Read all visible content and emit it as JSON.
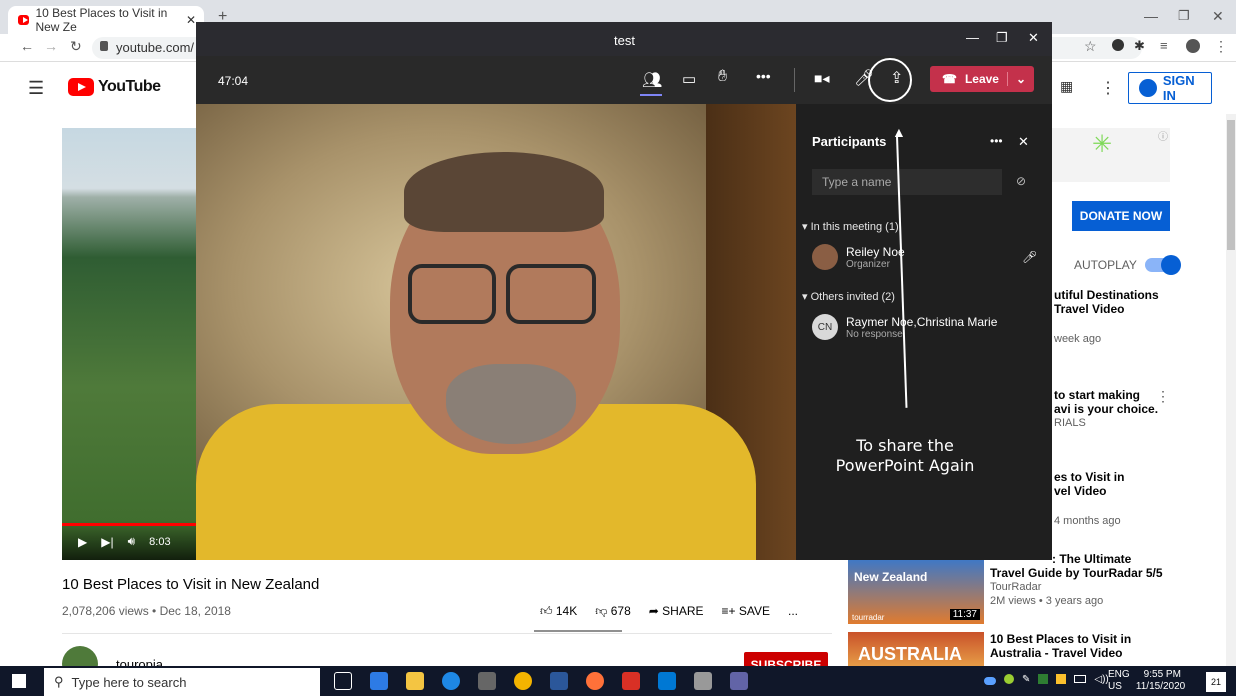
{
  "browser": {
    "tab_title": "10 Best Places to Visit in New Ze",
    "address": "youtube.com/"
  },
  "youtube": {
    "logo_text": "YouTube",
    "signin": "SIGN IN",
    "video_time": "8:03",
    "video_title": "10 Best Places to Visit in New Zealand",
    "video_meta": "2,078,206 views • Dec 18, 2018",
    "likes": "14K",
    "dislikes": "678",
    "share": "SHARE",
    "save": "SAVE",
    "more": "...",
    "channel": "touropia",
    "subscribe": "SUBSCRIBE",
    "donate": "DONATE NOW",
    "autoplay": "AUTOPLAY",
    "sidebar": [
      {
        "title_l1": "utiful Destinations",
        "title_l2": "Travel Video",
        "meta": "week ago"
      },
      {
        "title_l1": "to start making",
        "title_l2": "avi is your choice.",
        "meta": "RIALS"
      },
      {
        "title_l1": "es to Visit in",
        "title_l2": "vel Video",
        "meta": "4 months ago"
      },
      {
        "title_l1": ": The Ultimate",
        "title_l2": "Travel Guide by TourRadar 5/5",
        "channel": "TourRadar",
        "meta": "2M views • 3 years ago",
        "thumb_text": "New Zealand",
        "thumb_brand": "tourradar",
        "duration": "11:37"
      },
      {
        "title_l1": "10 Best Places to Visit in",
        "title_l2": "Australia - Travel Video",
        "thumb_text": "AUSTRALIA"
      }
    ]
  },
  "teams": {
    "window_title": "test",
    "timer": "47:04",
    "leave_label": "Leave",
    "panel_title": "Participants",
    "search_placeholder": "Type a name",
    "in_meeting": "In this meeting (1)",
    "participant_name": "Reiley Noe",
    "participant_role": "Organizer",
    "others_invited": "Others invited (2)",
    "invited_initials": "CN",
    "invited_name": "Raymer Noe,Christina Marie",
    "invited_status": "No response",
    "annotation_l1": "To share the",
    "annotation_l2": "PowerPoint Again"
  },
  "taskbar": {
    "search_placeholder": "Type here to search",
    "lang": "ENG",
    "region": "US",
    "time": "9:55 PM",
    "date": "11/15/2020",
    "notifications": "21"
  },
  "colors": {
    "teams_leave": "#c4314b",
    "youtube_red": "#ff0000",
    "youtube_blue": "#065fd4"
  }
}
